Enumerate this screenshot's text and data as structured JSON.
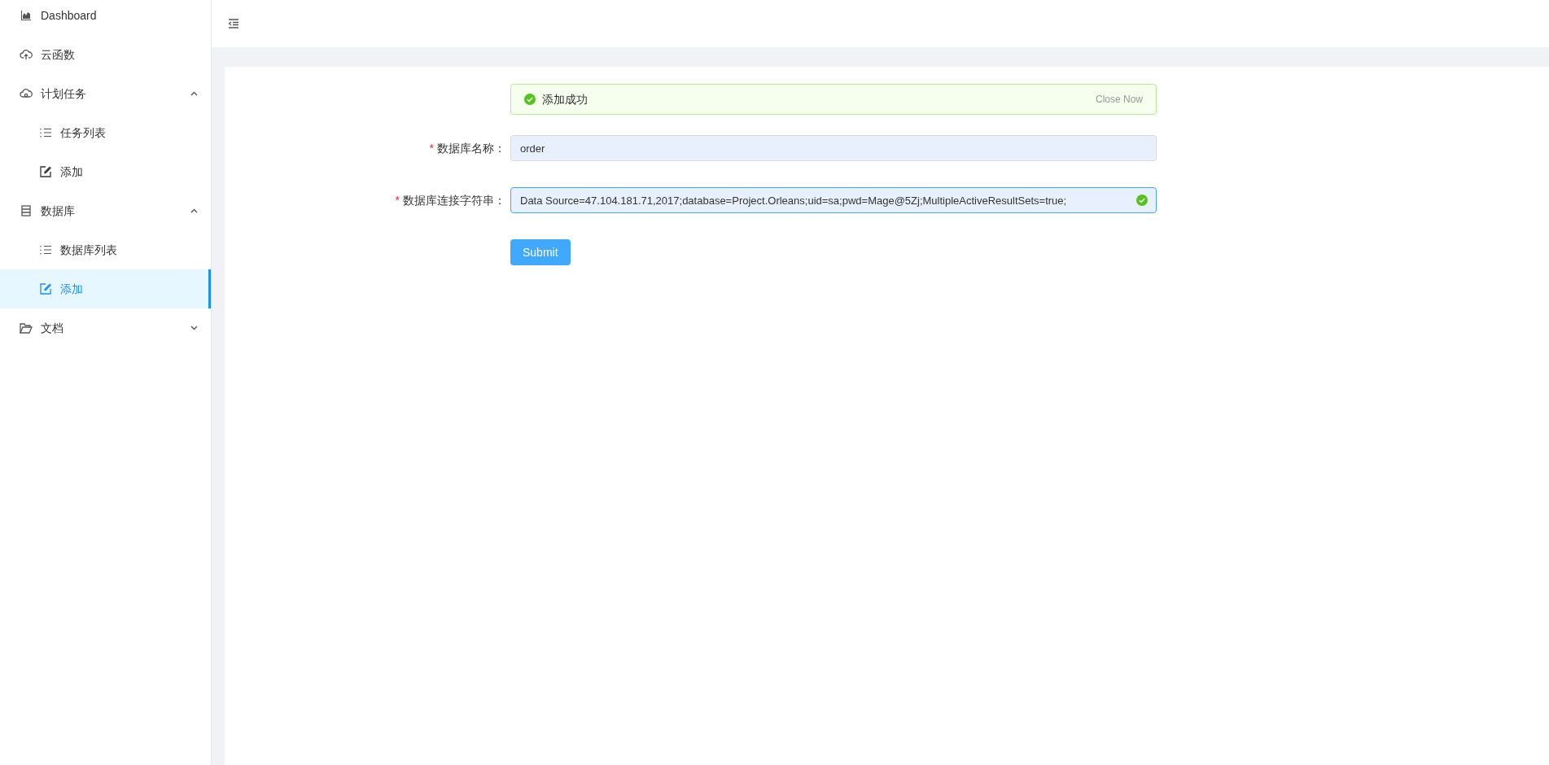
{
  "sidebar": {
    "items": [
      {
        "label": "Dashboard",
        "kind": "chart",
        "selected": false
      },
      {
        "label": "云函数",
        "kind": "cloud-upload",
        "selected": false
      },
      {
        "label": "计划任务",
        "kind": "cloud",
        "selected": false,
        "expanded": true,
        "children": [
          {
            "label": "任务列表",
            "kind": "list",
            "selected": false
          },
          {
            "label": "添加",
            "kind": "edit",
            "selected": false
          }
        ]
      },
      {
        "label": "数据库",
        "kind": "database",
        "selected": false,
        "expanded": true,
        "children": [
          {
            "label": "数据库列表",
            "kind": "list",
            "selected": false
          },
          {
            "label": "添加",
            "kind": "edit",
            "selected": true
          }
        ]
      },
      {
        "label": "文档",
        "kind": "folder",
        "selected": false,
        "expanded": false
      }
    ]
  },
  "alert": {
    "message": "添加成功",
    "close": "Close Now"
  },
  "form": {
    "fields": [
      {
        "label": "数据库名称：",
        "required_mark": "*",
        "value": "order",
        "validated": false
      },
      {
        "label": "数据库连接字符串：",
        "required_mark": "*",
        "value": "Data Source=47.104.181.71,2017;database=Project.Orleans;uid=sa;pwd=Mage@5Zj;MultipleActiveResultSets=true;",
        "validated": true
      }
    ],
    "submit": "Submit"
  }
}
